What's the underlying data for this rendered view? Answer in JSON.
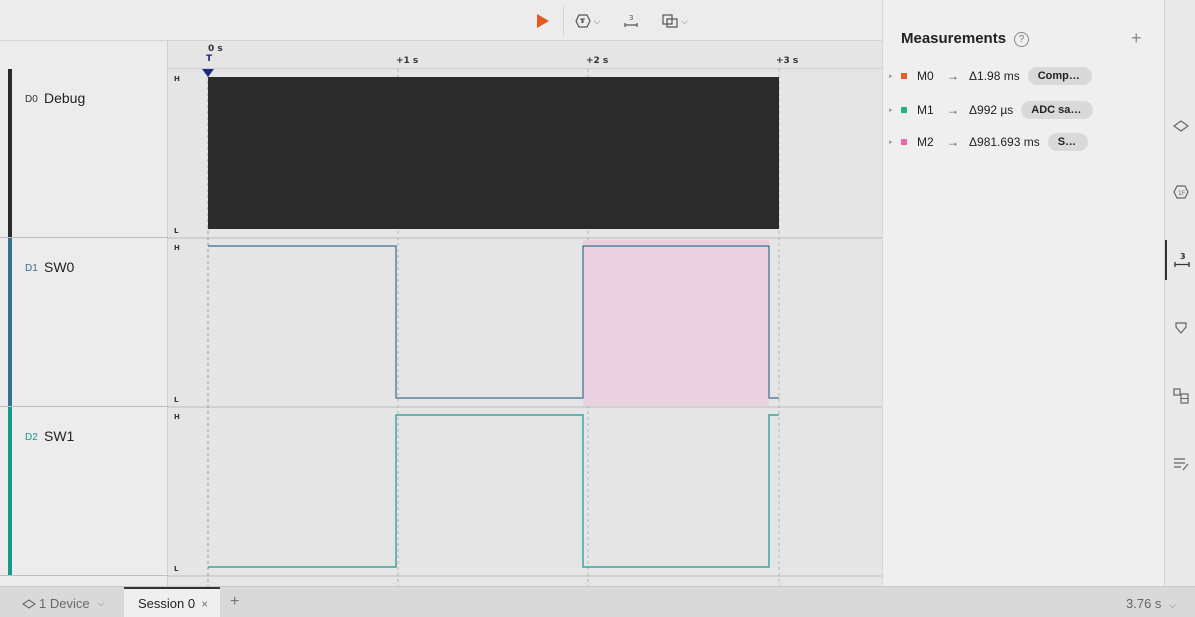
{
  "toolbar": {
    "play_icon": "play-icon",
    "trigger_icon": "trigger-icon",
    "measure_icon": "measure-icon",
    "layout_icon": "layout-icon"
  },
  "ruler": {
    "labels": [
      "0 s",
      "+1 s",
      "+2 s",
      "+3 s"
    ],
    "trigger_marker": "T"
  },
  "channels": [
    {
      "id": "D0",
      "name": "Debug",
      "color": "#2a2a2a",
      "high": "H",
      "low": "L"
    },
    {
      "id": "D1",
      "name": "SW0",
      "color": "#3a6f94",
      "high": "H",
      "low": "L"
    },
    {
      "id": "D2",
      "name": "SW1",
      "color": "#139a8c",
      "high": "H",
      "low": "L"
    }
  ],
  "measurements": {
    "title": "Measurements",
    "help_glyph": "?",
    "add_glyph": "+",
    "items": [
      {
        "name": "M0",
        "color": "#e0602a",
        "delta": "Δ1.98 ms",
        "label": "Comp…"
      },
      {
        "name": "M1",
        "color": "#1db583",
        "delta": "Δ992 µs",
        "label": "ADC sa…"
      },
      {
        "name": "M2",
        "color": "#ee6aa8",
        "delta": "Δ981.693 ms",
        "label": "S…"
      }
    ]
  },
  "bottom": {
    "device_label": "1 Device",
    "session_label": "Session 0",
    "close_glyph": "×",
    "add_glyph": "+",
    "duration": "3.76 s"
  },
  "colors": {
    "accent": "#e05a22",
    "highlight": "#ead1df",
    "debug_fill": "#2b2b2b"
  }
}
